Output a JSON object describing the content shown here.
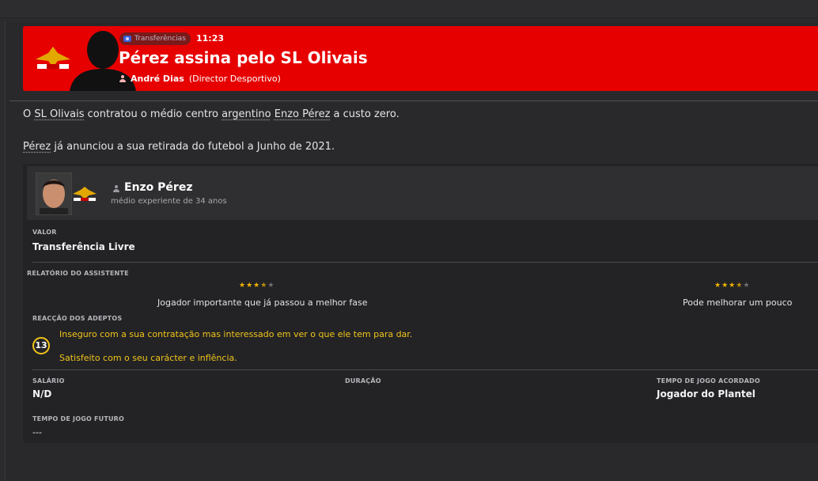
{
  "header": {
    "tag_label": "Transferências",
    "time": "11:23",
    "title": "Pérez assina pelo SL Olivais",
    "author": "André Dias",
    "author_role": "(Director Desportivo)",
    "bg_color": "#e60000"
  },
  "article": {
    "p1_before": "O ",
    "p1_link1": "SL Olivais",
    "p1_mid": " contratou o médio centro ",
    "p1_link2": "argentino",
    "p1_space": " ",
    "p1_link3": "Enzo Pérez",
    "p1_after": " a custo zero.",
    "p2_link": "Pérez",
    "p2_after": " já anunciou a sua retirada do futebol a Junho de 2021."
  },
  "player": {
    "name": "Enzo Pérez",
    "subtitle": "médio experiente de 34 anos"
  },
  "details": {
    "value_label": "VALOR",
    "value": "Transferência Livre",
    "assistant_label": "RELATÓRIO DO ASSISTENTE",
    "report_left": "Jogador importante que já passou a melhor fase",
    "report_right": "Pode melhorar um pouco",
    "rating_left": 3.5,
    "rating_right": 3.5,
    "fans_label": "REACÇÃO DOS ADEPTOS",
    "fans_count": "13",
    "fan_line1": "Inseguro com a sua contratação mas interessado em ver o que ele tem para dar.",
    "fan_line2": "Satisfeito com o seu carácter e inflência.",
    "salary_label": "SALÁRIO",
    "salary": "N/D",
    "duration_label": "DURAÇÃO",
    "playtime_label": "TEMPO DE JOGO ACORDADO",
    "playtime": "Jogador do Plantel",
    "future_label": "TEMPO DE JOGO FUTURO",
    "future": "---"
  }
}
